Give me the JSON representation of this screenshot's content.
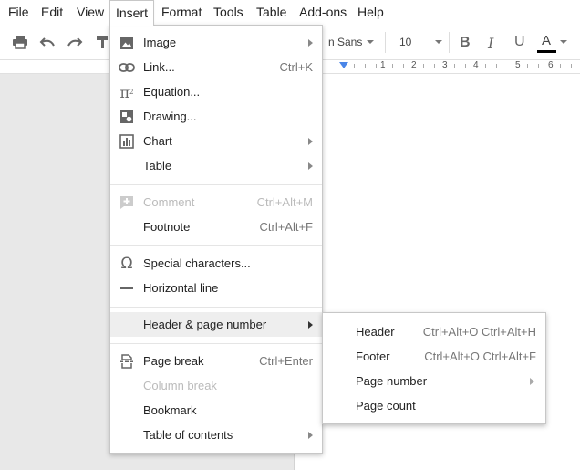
{
  "menubar": {
    "items": [
      {
        "label": "File"
      },
      {
        "label": "Edit"
      },
      {
        "label": "View"
      },
      {
        "label": "Insert"
      },
      {
        "label": "Format"
      },
      {
        "label": "Tools"
      },
      {
        "label": "Table"
      },
      {
        "label": "Add-ons"
      },
      {
        "label": "Help"
      }
    ],
    "active": "Insert"
  },
  "toolbar": {
    "font_name": "n Sans",
    "font_size": "10",
    "bold": "B",
    "italic": "I",
    "underline": "U",
    "text_color": "A",
    "text_color_swatch": "#000000"
  },
  "ruler": {
    "numbers": [
      "1",
      "2",
      "3",
      "4",
      "5",
      "6"
    ]
  },
  "insert_menu": {
    "items": [
      {
        "label": "Image",
        "icon": "image-icon",
        "submenu": true
      },
      {
        "label": "Link...",
        "icon": "link-icon",
        "shortcut": "Ctrl+K"
      },
      {
        "label": "Equation...",
        "icon": "pi-icon"
      },
      {
        "label": "Drawing...",
        "icon": "drawing-icon"
      },
      {
        "label": "Chart",
        "icon": "chart-icon",
        "submenu": true
      },
      {
        "label": "Table",
        "submenu": true
      },
      {
        "label": "Comment",
        "icon": "comment-icon",
        "shortcut": "Ctrl+Alt+M",
        "disabled": true
      },
      {
        "label": "Footnote",
        "shortcut": "Ctrl+Alt+F"
      },
      {
        "label": "Special characters...",
        "icon": "omega-icon"
      },
      {
        "label": "Horizontal line",
        "icon": "horizontal-line-icon"
      },
      {
        "label": "Header & page number",
        "submenu": true,
        "highlighted": true
      },
      {
        "label": "Page break",
        "icon": "page-break-icon",
        "shortcut": "Ctrl+Enter"
      },
      {
        "label": "Column break",
        "disabled": true
      },
      {
        "label": "Bookmark"
      },
      {
        "label": "Table of contents",
        "submenu": true
      }
    ]
  },
  "header_submenu": {
    "items": [
      {
        "label": "Header",
        "shortcut": "Ctrl+Alt+O Ctrl+Alt+H"
      },
      {
        "label": "Footer",
        "shortcut": "Ctrl+Alt+O Ctrl+Alt+F"
      },
      {
        "label": "Page number",
        "submenu": true
      },
      {
        "label": "Page count"
      }
    ]
  },
  "colors": {
    "highlight_bg": "#eeeeee",
    "menu_border": "#c7c7c7",
    "disabled_text": "#bbbbbb",
    "canvas_bg": "#e8e8e8",
    "ruler_marker": "#4a86e8"
  }
}
